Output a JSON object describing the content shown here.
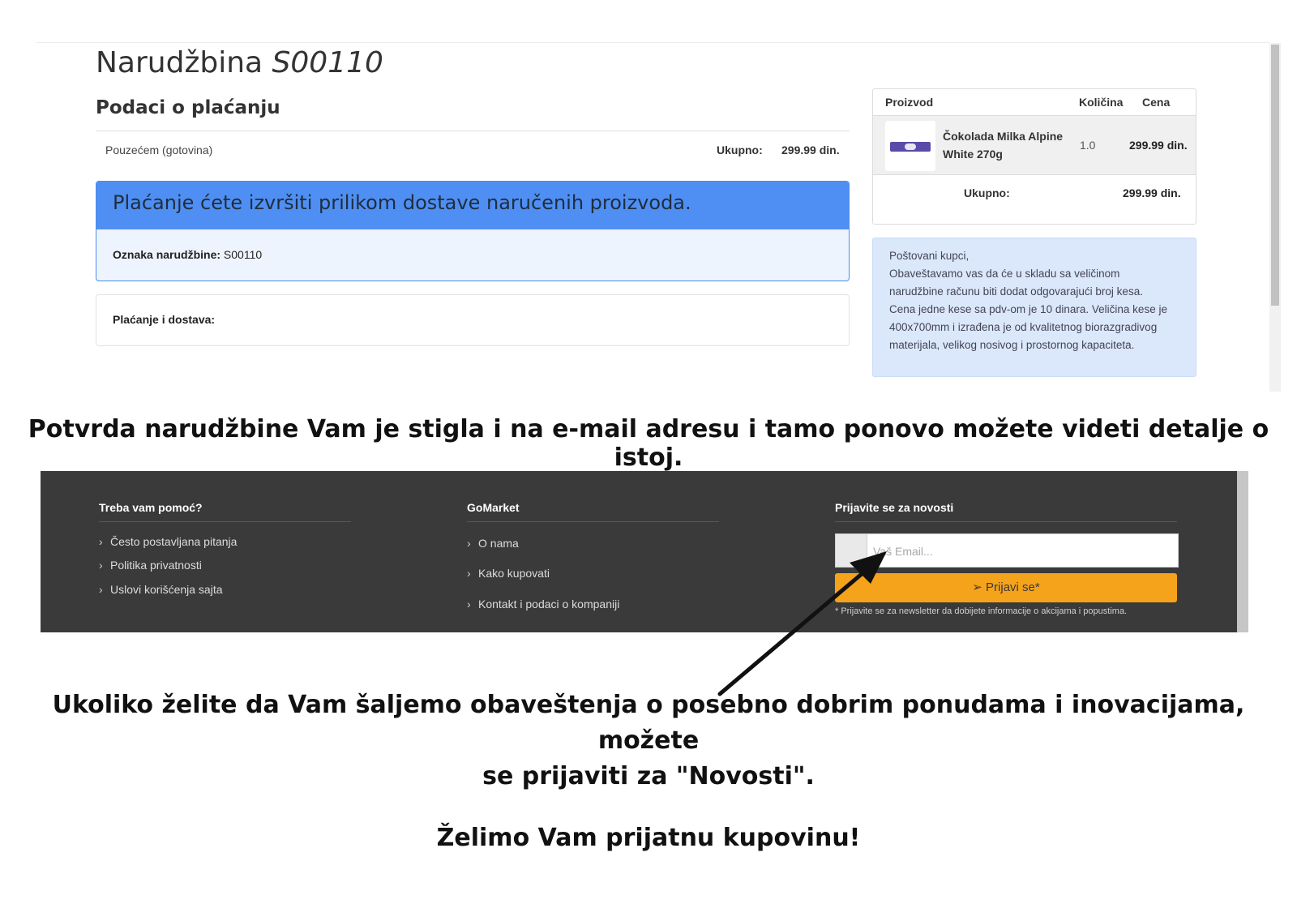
{
  "order": {
    "title_prefix": "Narudžbina",
    "number": "S00110",
    "payment_heading": "Podaci o plaćanju",
    "payment_method": "Pouzećem (gotovina)",
    "total_label": "Ukupno:",
    "total_value": "299.99 din.",
    "notice_heading": "Plaćanje ćete izvršiti prilikom dostave naručenih proizvoda.",
    "order_ref_label": "Oznaka narudžbine:",
    "order_ref_value": "S00110",
    "shipping_label": "Plaćanje i dostava:"
  },
  "cart": {
    "headers": {
      "product": "Proizvod",
      "quantity": "Količina",
      "price": "Cena"
    },
    "items": [
      {
        "name": "Čokolada Milka Alpine White 270g",
        "quantity": "1.0",
        "price": "299.99 din."
      }
    ],
    "total_label": "Ukupno:",
    "total_value": "299.99 din."
  },
  "info_notice": {
    "lines": [
      "Poštovani kupci,",
      "Obaveštavamo vas da će u skladu sa veličinom",
      "narudžbine računu biti dodat odgovarajući broj kesa.",
      "Cena jedne kese sa pdv-om je 10 dinara. Veličina kese je",
      "400x700mm i izrađena je od kvalitetnog biorazgradivog",
      "materijala, velikog nosivog i prostornog kapaciteta."
    ]
  },
  "captions": {
    "email_confirmation": "Potvrda narudžbine Vam je stigla i na e-mail adresu i tamo ponovo možete videti detalje o istoj.",
    "newsletter_line1": "Ukoliko želite da Vam šaljemo obaveštenja o posebno dobrim ponudama i inovacijama, možete",
    "newsletter_line2": "se prijaviti za \"Novosti\".",
    "closing": "Želimo Vam prijatnu kupovinu!"
  },
  "footer": {
    "help": {
      "title": "Treba vam pomoć?",
      "links": [
        "Često postavljana pitanja",
        "Politika privatnosti",
        "Uslovi korišćenja sajta"
      ]
    },
    "company": {
      "title": "GoMarket",
      "links": [
        "O nama",
        "Kako kupovati",
        "Kontakt i podaci o kompaniji"
      ]
    },
    "newsletter": {
      "title": "Prijavite se za novosti",
      "email_placeholder": "Vaš Email...",
      "button_label": "Prijavi se*",
      "fine_print": "* Prijavite se za newsletter da dobijete informacije o akcijama i popustima."
    }
  },
  "colors": {
    "notice_blue": "#4f8ff3",
    "info_bg": "#dbe8fb",
    "footer_bg": "#3a3a3a",
    "subscribe_orange": "#f5a31a"
  },
  "icons": {
    "chevron": "chevron-right-icon",
    "send": "paper-plane-icon",
    "arrow": "pointer-arrow-icon"
  }
}
